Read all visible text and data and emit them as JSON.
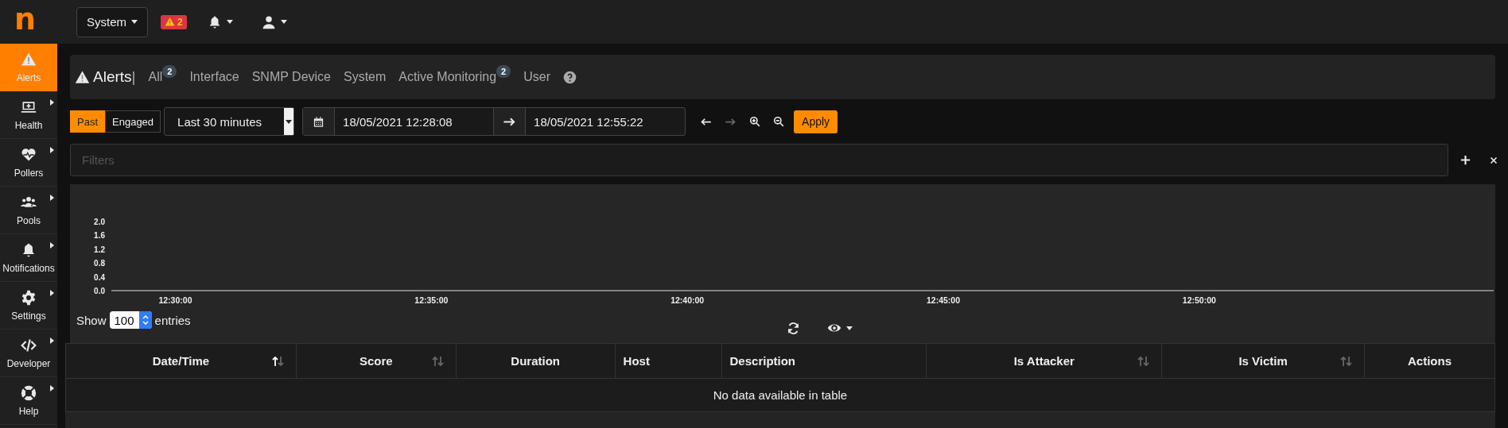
{
  "topbar": {
    "logo": "n",
    "interface": "System",
    "alert_badge": "2"
  },
  "sidebar": {
    "items": [
      {
        "label": "Alerts",
        "kind": "warning",
        "selected": true
      },
      {
        "label": "Health",
        "kind": "monitor",
        "selected": false
      },
      {
        "label": "Pollers",
        "kind": "heart",
        "selected": false
      },
      {
        "label": "Pools",
        "kind": "users",
        "selected": false
      },
      {
        "label": "Notifications",
        "kind": "bell",
        "selected": false
      },
      {
        "label": "Settings",
        "kind": "gear",
        "selected": false
      },
      {
        "label": "Developer",
        "kind": "code",
        "selected": false
      },
      {
        "label": "Help",
        "kind": "lifebuoy",
        "selected": false
      }
    ]
  },
  "alerts_nav": {
    "title": "Alerts",
    "separator": "|",
    "tabs": [
      {
        "label": "All",
        "badge": "2"
      },
      {
        "label": "Interface"
      },
      {
        "label": "SNMP Device"
      },
      {
        "label": "System"
      },
      {
        "label": "Active Monitoring",
        "badge": "2"
      },
      {
        "label": "User"
      }
    ]
  },
  "toolbar": {
    "modes": [
      {
        "label": "Past",
        "selected": true
      },
      {
        "label": "Engaged",
        "selected": false
      }
    ],
    "range": "Last 30 minutes",
    "begin": "18/05/2021 12:28:08",
    "end": "18/05/2021 12:55:22",
    "apply": "Apply"
  },
  "filters": {
    "placeholder": "Filters"
  },
  "chart": {
    "chart_data": {
      "type": "line",
      "yticks": [
        {
          "value": 0,
          "label": "0.0"
        },
        {
          "value": 0.4,
          "label": "0.4"
        },
        {
          "value": 0.8,
          "label": "0.8"
        },
        {
          "value": 1.2,
          "label": "1.2"
        },
        {
          "value": 1.6,
          "label": "1.6"
        },
        {
          "value": 2,
          "label": "2.0"
        }
      ],
      "ylim": [
        0,
        2
      ],
      "categories": [
        "12:30:00",
        "12:35:00",
        "12:40:00",
        "12:45:00",
        "12:50:00"
      ]
    }
  },
  "length": {
    "show": "Show",
    "value": "100",
    "entries": "entries"
  },
  "table": {
    "columns": [
      {
        "label": "Date/Time",
        "sorted": true
      },
      {
        "label": "Score",
        "sorted": false
      },
      {
        "label": "Duration"
      },
      {
        "label": "Host"
      },
      {
        "label": "Description"
      },
      {
        "label": "Is Attacker",
        "sorted": false
      },
      {
        "label": "Is Victim",
        "sorted": false
      },
      {
        "label": "Actions"
      }
    ],
    "empty": "No data available in table"
  }
}
